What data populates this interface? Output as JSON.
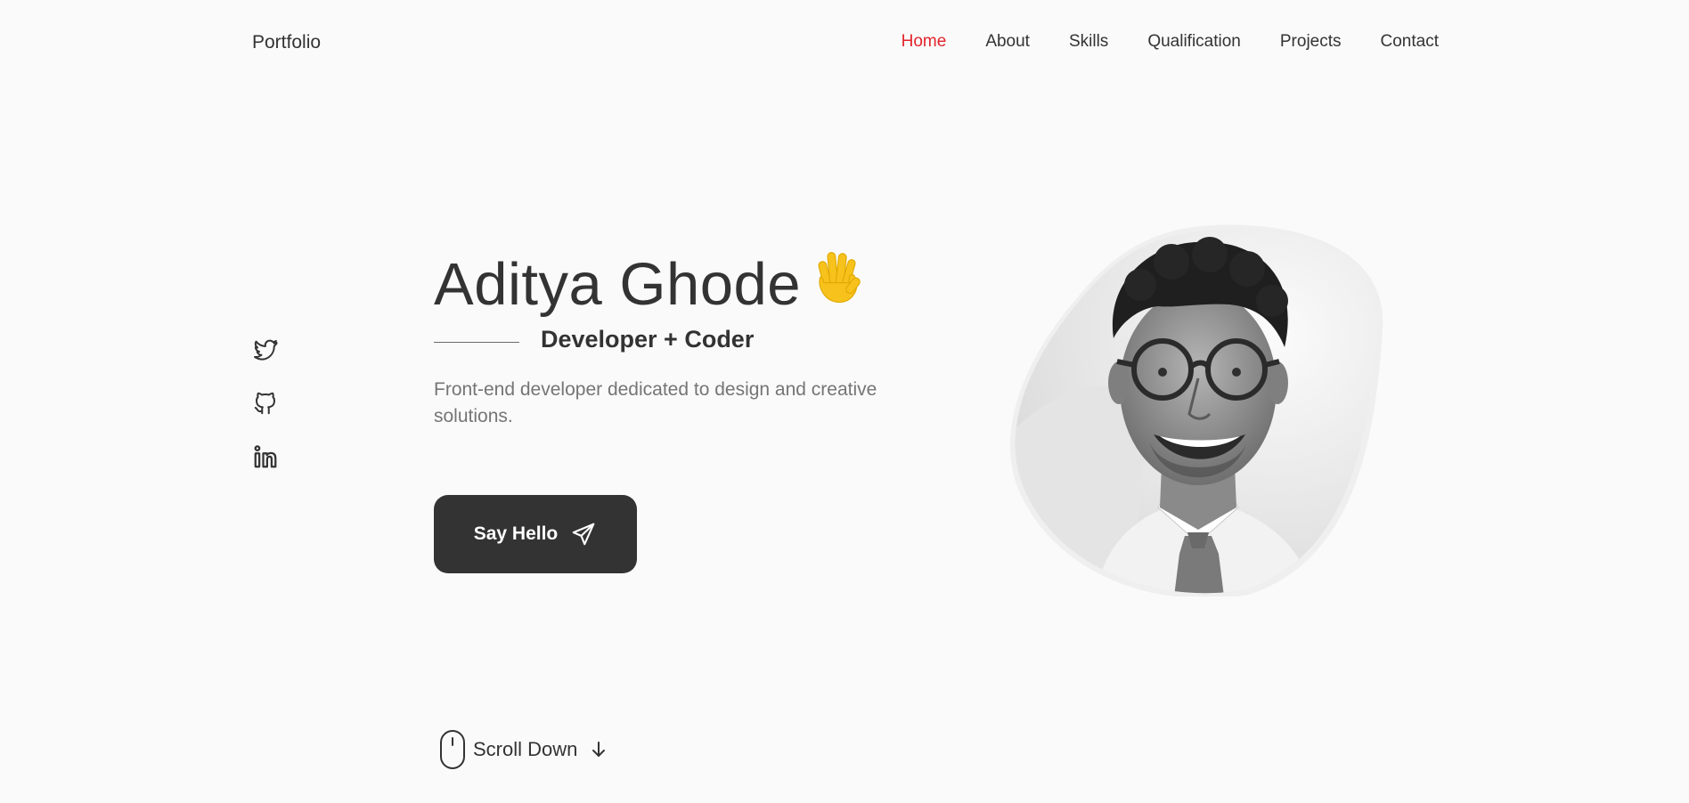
{
  "header": {
    "logo": "Portfolio",
    "nav": [
      {
        "label": "Home",
        "active": true
      },
      {
        "label": "About",
        "active": false
      },
      {
        "label": "Skills",
        "active": false
      },
      {
        "label": "Qualification",
        "active": false
      },
      {
        "label": "Projects",
        "active": false
      },
      {
        "label": "Contact",
        "active": false
      }
    ]
  },
  "social": [
    {
      "icon": "twitter-icon"
    },
    {
      "icon": "github-icon"
    },
    {
      "icon": "linkedin-icon"
    }
  ],
  "hero": {
    "name": "Aditya Ghode",
    "wave_icon": "waving-hand-icon",
    "subtitle": "Developer + Coder",
    "description": "Front-end developer dedicated to design and creative solutions.",
    "cta_label": "Say Hello",
    "cta_icon": "send-icon"
  },
  "profile_image": {
    "alt": "profile-photo",
    "style": "grayscale portrait in organic blob shape"
  },
  "scroll": {
    "label": "Scroll Down",
    "icon": "mouse-icon",
    "arrow_icon": "arrow-down-icon"
  },
  "colors": {
    "background": "#fafafa",
    "text": "#333333",
    "accent": "#e3242b",
    "muted": "#757575",
    "button": "#333333"
  }
}
